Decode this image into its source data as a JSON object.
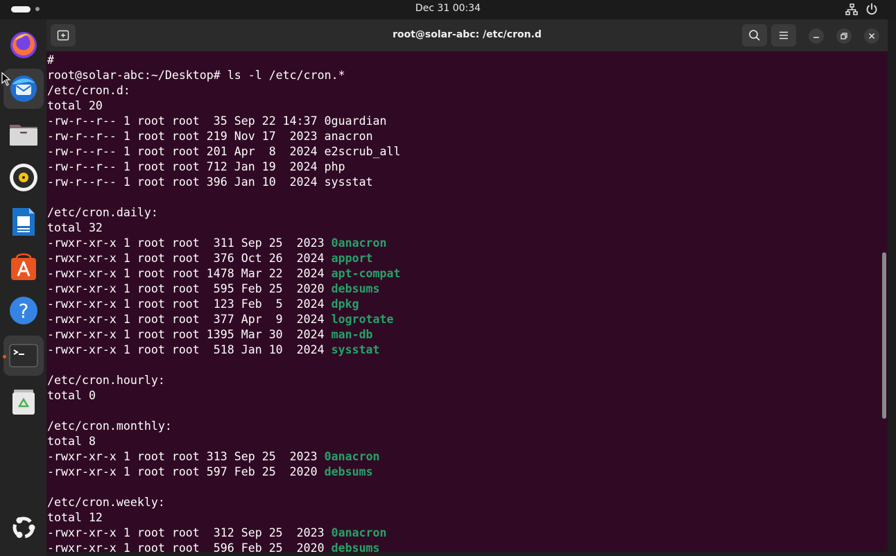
{
  "topbar": {
    "clock": "Dec 31  00:34"
  },
  "dock": {
    "items": [
      {
        "name": "firefox",
        "icon": "firefox-icon"
      },
      {
        "name": "thunderbird",
        "icon": "thunderbird-icon"
      },
      {
        "name": "files",
        "icon": "files-icon"
      },
      {
        "name": "rhythmbox",
        "icon": "rhythmbox-icon"
      },
      {
        "name": "libreoffice-writer",
        "icon": "writer-icon"
      },
      {
        "name": "app-center",
        "icon": "app-center-icon"
      },
      {
        "name": "help",
        "icon": "help-icon"
      },
      {
        "name": "terminal",
        "icon": "terminal-icon",
        "active": true
      },
      {
        "name": "trash",
        "icon": "trash-icon"
      },
      {
        "name": "show-apps",
        "icon": "ubuntu-icon"
      }
    ]
  },
  "window": {
    "title": "root@solar-abc: /etc/cron.d"
  },
  "colors": {
    "terminal_bg": "#300a24",
    "executable": "#26a269",
    "text": "#ffffff",
    "accent": "#e95420"
  },
  "terminal": {
    "lines": [
      {
        "text": "#"
      },
      {
        "text": "root@solar-abc:~/Desktop# ls -l /etc/cron.*"
      },
      {
        "text": "/etc/cron.d:"
      },
      {
        "text": "total 20"
      },
      {
        "text": "-rw-r--r-- 1 root root  35 Sep 22 14:37 ",
        "name": "0guardian",
        "exec": false
      },
      {
        "text": "-rw-r--r-- 1 root root 219 Nov 17  2023 ",
        "name": "anacron",
        "exec": false
      },
      {
        "text": "-rw-r--r-- 1 root root 201 Apr  8  2024 ",
        "name": "e2scrub_all",
        "exec": false
      },
      {
        "text": "-rw-r--r-- 1 root root 712 Jan 19  2024 ",
        "name": "php",
        "exec": false
      },
      {
        "text": "-rw-r--r-- 1 root root 396 Jan 10  2024 ",
        "name": "sysstat",
        "exec": false
      },
      {
        "text": ""
      },
      {
        "text": "/etc/cron.daily:"
      },
      {
        "text": "total 32"
      },
      {
        "text": "-rwxr-xr-x 1 root root  311 Sep 25  2023 ",
        "name": "0anacron",
        "exec": true
      },
      {
        "text": "-rwxr-xr-x 1 root root  376 Oct 26  2024 ",
        "name": "apport",
        "exec": true
      },
      {
        "text": "-rwxr-xr-x 1 root root 1478 Mar 22  2024 ",
        "name": "apt-compat",
        "exec": true
      },
      {
        "text": "-rwxr-xr-x 1 root root  595 Feb 25  2020 ",
        "name": "debsums",
        "exec": true
      },
      {
        "text": "-rwxr-xr-x 1 root root  123 Feb  5  2024 ",
        "name": "dpkg",
        "exec": true
      },
      {
        "text": "-rwxr-xr-x 1 root root  377 Apr  9  2024 ",
        "name": "logrotate",
        "exec": true
      },
      {
        "text": "-rwxr-xr-x 1 root root 1395 Mar 30  2024 ",
        "name": "man-db",
        "exec": true
      },
      {
        "text": "-rwxr-xr-x 1 root root  518 Jan 10  2024 ",
        "name": "sysstat",
        "exec": true
      },
      {
        "text": ""
      },
      {
        "text": "/etc/cron.hourly:"
      },
      {
        "text": "total 0"
      },
      {
        "text": ""
      },
      {
        "text": "/etc/cron.monthly:"
      },
      {
        "text": "total 8"
      },
      {
        "text": "-rwxr-xr-x 1 root root 313 Sep 25  2023 ",
        "name": "0anacron",
        "exec": true
      },
      {
        "text": "-rwxr-xr-x 1 root root 597 Feb 25  2020 ",
        "name": "debsums",
        "exec": true
      },
      {
        "text": ""
      },
      {
        "text": "/etc/cron.weekly:"
      },
      {
        "text": "total 12"
      },
      {
        "text": "-rwxr-xr-x 1 root root  312 Sep 25  2023 ",
        "name": "0anacron",
        "exec": true
      },
      {
        "text": "-rwxr-xr-x 1 root root  596 Feb 25  2020 ",
        "name": "debsums",
        "exec": true
      }
    ]
  }
}
